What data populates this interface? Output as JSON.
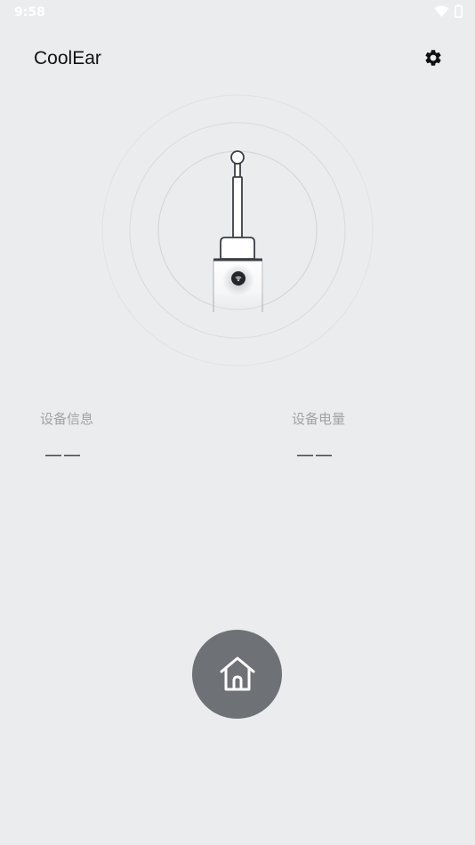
{
  "status_bar": {
    "time": "9:58",
    "icons": [
      "wifi-icon",
      "battery-icon"
    ]
  },
  "header": {
    "title": "CoolEar",
    "settings_icon": "gear-icon"
  },
  "device": {
    "illustration": "otoscope-device",
    "connection_icon": "wifi-icon"
  },
  "info": {
    "device_info_label": "设备信息",
    "device_info_value": "——",
    "battery_label": "设备电量",
    "battery_value": "——"
  },
  "nav": {
    "home_icon": "home-icon"
  },
  "colors": {
    "background": "#ebecee",
    "home_button": "#6e7176",
    "label": "#a0a2a6"
  }
}
